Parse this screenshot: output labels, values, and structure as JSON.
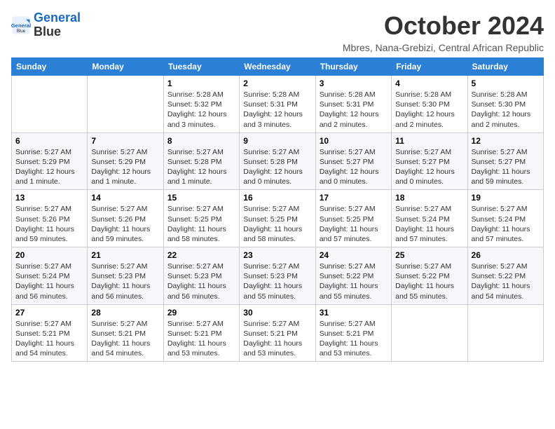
{
  "logo": {
    "line1": "General",
    "line2": "Blue"
  },
  "title": "October 2024",
  "subtitle": "Mbres, Nana-Grebizi, Central African Republic",
  "weekdays": [
    "Sunday",
    "Monday",
    "Tuesday",
    "Wednesday",
    "Thursday",
    "Friday",
    "Saturday"
  ],
  "weeks": [
    [
      {
        "day": null,
        "info": null
      },
      {
        "day": null,
        "info": null
      },
      {
        "day": "1",
        "info": "Sunrise: 5:28 AM\nSunset: 5:32 PM\nDaylight: 12 hours and 3 minutes."
      },
      {
        "day": "2",
        "info": "Sunrise: 5:28 AM\nSunset: 5:31 PM\nDaylight: 12 hours and 3 minutes."
      },
      {
        "day": "3",
        "info": "Sunrise: 5:28 AM\nSunset: 5:31 PM\nDaylight: 12 hours and 2 minutes."
      },
      {
        "day": "4",
        "info": "Sunrise: 5:28 AM\nSunset: 5:30 PM\nDaylight: 12 hours and 2 minutes."
      },
      {
        "day": "5",
        "info": "Sunrise: 5:28 AM\nSunset: 5:30 PM\nDaylight: 12 hours and 2 minutes."
      }
    ],
    [
      {
        "day": "6",
        "info": "Sunrise: 5:27 AM\nSunset: 5:29 PM\nDaylight: 12 hours and 1 minute."
      },
      {
        "day": "7",
        "info": "Sunrise: 5:27 AM\nSunset: 5:29 PM\nDaylight: 12 hours and 1 minute."
      },
      {
        "day": "8",
        "info": "Sunrise: 5:27 AM\nSunset: 5:28 PM\nDaylight: 12 hours and 1 minute."
      },
      {
        "day": "9",
        "info": "Sunrise: 5:27 AM\nSunset: 5:28 PM\nDaylight: 12 hours and 0 minutes."
      },
      {
        "day": "10",
        "info": "Sunrise: 5:27 AM\nSunset: 5:27 PM\nDaylight: 12 hours and 0 minutes."
      },
      {
        "day": "11",
        "info": "Sunrise: 5:27 AM\nSunset: 5:27 PM\nDaylight: 12 hours and 0 minutes."
      },
      {
        "day": "12",
        "info": "Sunrise: 5:27 AM\nSunset: 5:27 PM\nDaylight: 11 hours and 59 minutes."
      }
    ],
    [
      {
        "day": "13",
        "info": "Sunrise: 5:27 AM\nSunset: 5:26 PM\nDaylight: 11 hours and 59 minutes."
      },
      {
        "day": "14",
        "info": "Sunrise: 5:27 AM\nSunset: 5:26 PM\nDaylight: 11 hours and 59 minutes."
      },
      {
        "day": "15",
        "info": "Sunrise: 5:27 AM\nSunset: 5:25 PM\nDaylight: 11 hours and 58 minutes."
      },
      {
        "day": "16",
        "info": "Sunrise: 5:27 AM\nSunset: 5:25 PM\nDaylight: 11 hours and 58 minutes."
      },
      {
        "day": "17",
        "info": "Sunrise: 5:27 AM\nSunset: 5:25 PM\nDaylight: 11 hours and 57 minutes."
      },
      {
        "day": "18",
        "info": "Sunrise: 5:27 AM\nSunset: 5:24 PM\nDaylight: 11 hours and 57 minutes."
      },
      {
        "day": "19",
        "info": "Sunrise: 5:27 AM\nSunset: 5:24 PM\nDaylight: 11 hours and 57 minutes."
      }
    ],
    [
      {
        "day": "20",
        "info": "Sunrise: 5:27 AM\nSunset: 5:24 PM\nDaylight: 11 hours and 56 minutes."
      },
      {
        "day": "21",
        "info": "Sunrise: 5:27 AM\nSunset: 5:23 PM\nDaylight: 11 hours and 56 minutes."
      },
      {
        "day": "22",
        "info": "Sunrise: 5:27 AM\nSunset: 5:23 PM\nDaylight: 11 hours and 56 minutes."
      },
      {
        "day": "23",
        "info": "Sunrise: 5:27 AM\nSunset: 5:23 PM\nDaylight: 11 hours and 55 minutes."
      },
      {
        "day": "24",
        "info": "Sunrise: 5:27 AM\nSunset: 5:22 PM\nDaylight: 11 hours and 55 minutes."
      },
      {
        "day": "25",
        "info": "Sunrise: 5:27 AM\nSunset: 5:22 PM\nDaylight: 11 hours and 55 minutes."
      },
      {
        "day": "26",
        "info": "Sunrise: 5:27 AM\nSunset: 5:22 PM\nDaylight: 11 hours and 54 minutes."
      }
    ],
    [
      {
        "day": "27",
        "info": "Sunrise: 5:27 AM\nSunset: 5:21 PM\nDaylight: 11 hours and 54 minutes."
      },
      {
        "day": "28",
        "info": "Sunrise: 5:27 AM\nSunset: 5:21 PM\nDaylight: 11 hours and 54 minutes."
      },
      {
        "day": "29",
        "info": "Sunrise: 5:27 AM\nSunset: 5:21 PM\nDaylight: 11 hours and 53 minutes."
      },
      {
        "day": "30",
        "info": "Sunrise: 5:27 AM\nSunset: 5:21 PM\nDaylight: 11 hours and 53 minutes."
      },
      {
        "day": "31",
        "info": "Sunrise: 5:27 AM\nSunset: 5:21 PM\nDaylight: 11 hours and 53 minutes."
      },
      {
        "day": null,
        "info": null
      },
      {
        "day": null,
        "info": null
      }
    ]
  ]
}
